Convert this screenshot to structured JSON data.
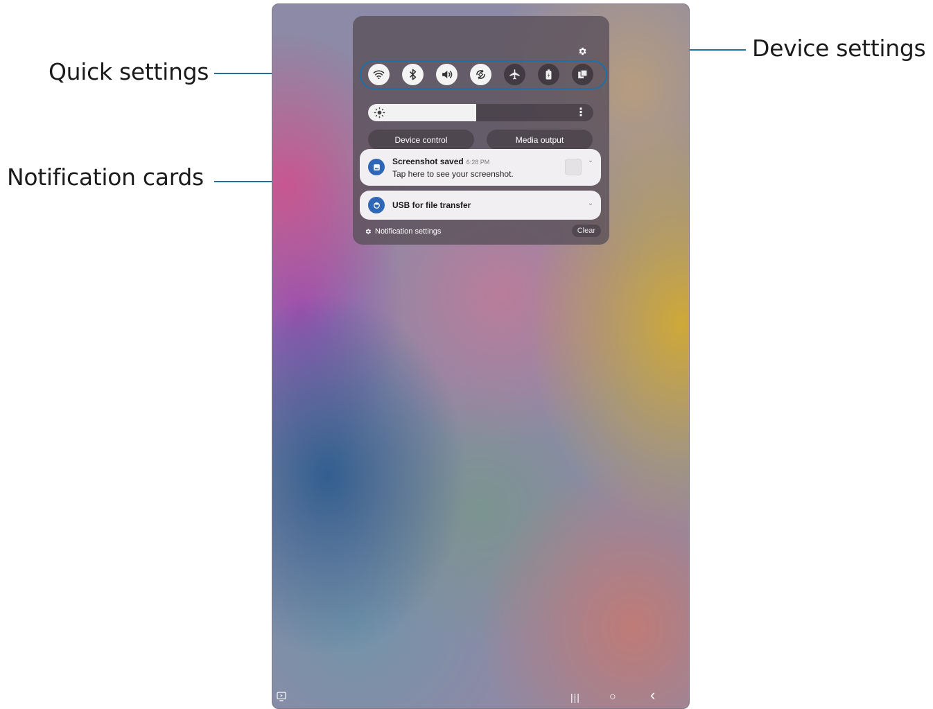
{
  "callouts": {
    "quick_settings": "Quick settings",
    "notification_cards": "Notification cards",
    "device_settings": "Device settings"
  },
  "colors": {
    "callout_line": "#1f6fa6",
    "notification_icon": "#2d67b5"
  },
  "quick_panel": {
    "settings_icon": "gear-icon",
    "toggles": [
      {
        "name": "wifi",
        "icon": "wifi-icon",
        "on": true
      },
      {
        "name": "bluetooth",
        "icon": "bluetooth-icon",
        "on": true
      },
      {
        "name": "sound",
        "icon": "sound-icon",
        "on": true
      },
      {
        "name": "auto-rotate",
        "icon": "rotate-icon",
        "on": true
      },
      {
        "name": "airplane-mode",
        "icon": "airplane-icon",
        "on": false
      },
      {
        "name": "power-saving",
        "icon": "battery-icon",
        "on": false
      },
      {
        "name": "multi-window",
        "icon": "multi-window-icon",
        "on": false
      }
    ],
    "brightness": {
      "level": 0.48
    },
    "device_control_label": "Device control",
    "media_output_label": "Media output"
  },
  "notifications": [
    {
      "title": "Screenshot saved",
      "time": "6:28 PM",
      "text": "Tap here to see your screenshot."
    },
    {
      "title": "USB for file transfer"
    }
  ],
  "footer": {
    "notification_settings_label": "Notification settings",
    "clear_label": "Clear"
  },
  "navbar": {
    "recents": "|||",
    "home": "○",
    "back": "‹"
  }
}
